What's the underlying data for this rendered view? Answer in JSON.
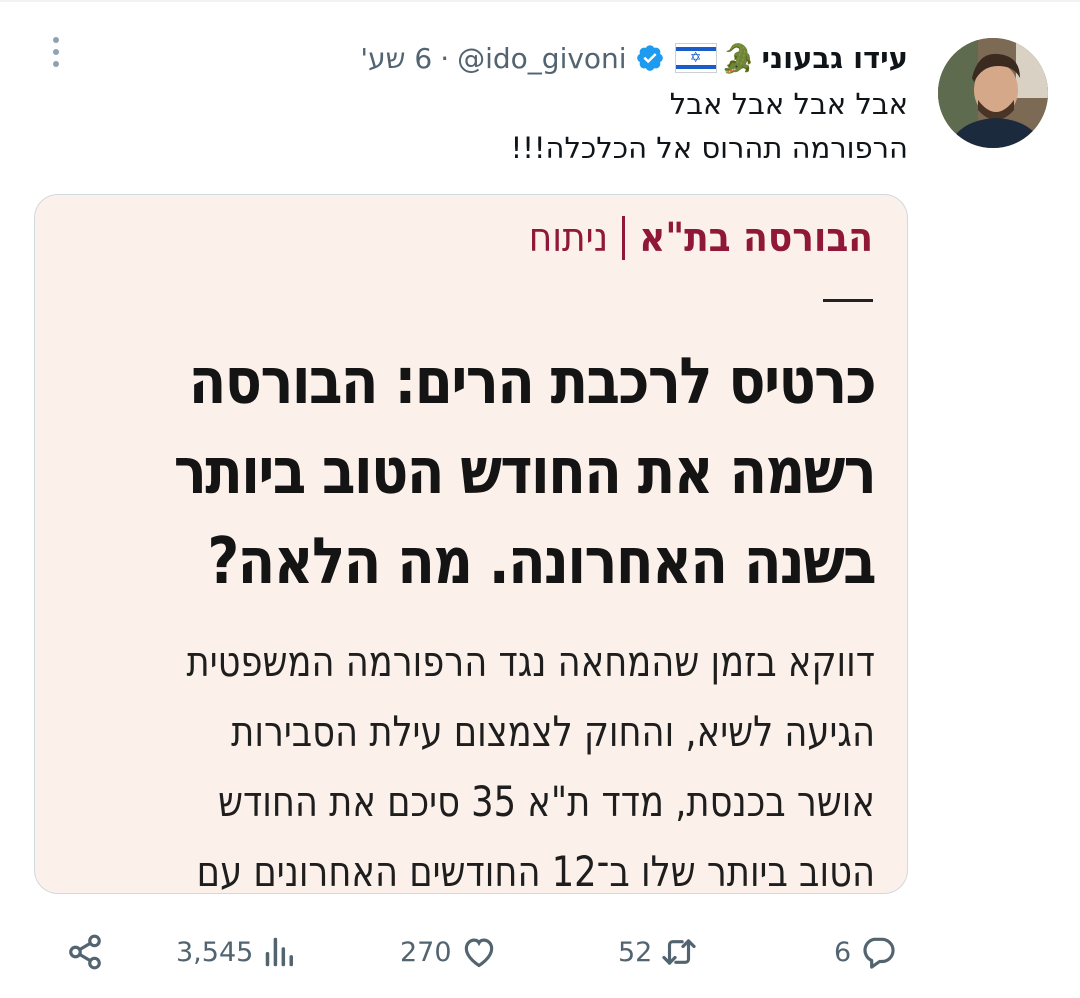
{
  "tweet": {
    "author_name": "עידו גבעוני",
    "author_emojis": [
      "crocodile-emoji",
      "israel-flag-emoji"
    ],
    "handle": "@ido_givoni",
    "separator": "·",
    "time": "6 שע'",
    "text_lines": [
      "אבל אבל אבל אבל",
      "הרפורמה תהרוס אל הכלכלה!!!"
    ]
  },
  "article_image": {
    "kicker": "הבורסה בת\"א",
    "section": "ניתוח",
    "headline_lines": [
      "כרטיס לרכבת הרים: הבורסה",
      "רשמה את החודש הטוב ביותר",
      "בשנה האחרונה. מה הלאה?"
    ],
    "body_lines": [
      "דווקא בזמן שהמחאה נגד הרפורמה המשפטית",
      "הגיעה לשיא, והחוק לצמצום עילת הסבירות",
      "אושר בכנסת, מדד ת\"א 35 סיכם את החודש",
      "הטוב ביותר שלו ב־12 החודשים האחרונים עם"
    ]
  },
  "actions": {
    "replies": "6",
    "retweets": "52",
    "likes": "270",
    "views": "3,545"
  },
  "colors": {
    "text_primary": "#0f1419",
    "text_secondary": "#536471",
    "verified": "#1d9bf0",
    "kicker": "#8f1838",
    "card_bg": "#fcf1ea"
  }
}
